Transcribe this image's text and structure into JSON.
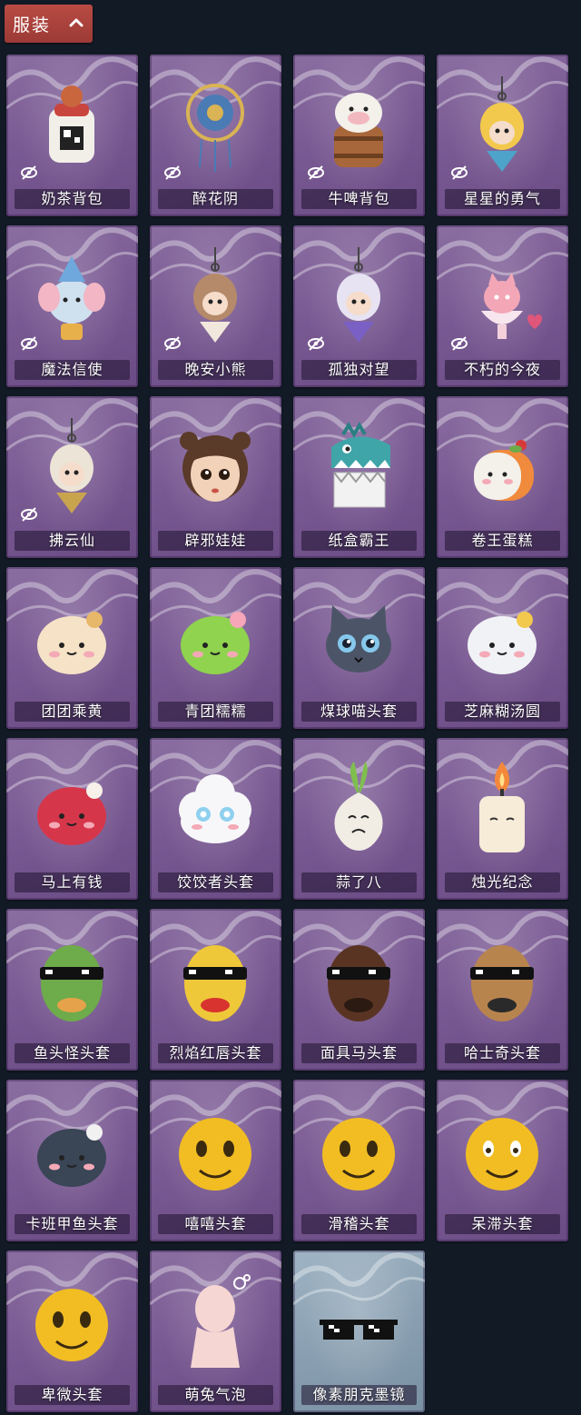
{
  "section": {
    "title": "服装"
  },
  "items": [
    {
      "name": "奶茶背包",
      "hidden": true,
      "art": "backpack",
      "c1": "#f2efe9",
      "c2": "#c9463e",
      "rarity": "purple"
    },
    {
      "name": "醉花阴",
      "hidden": true,
      "art": "ornament",
      "c1": "#4a7bb5",
      "c2": "#d9b354",
      "rarity": "purple"
    },
    {
      "name": "牛啤背包",
      "hidden": true,
      "art": "barrel",
      "c1": "#a8673a",
      "c2": "#f4f0ea",
      "rarity": "purple"
    },
    {
      "name": "星星的勇气",
      "hidden": true,
      "art": "charm",
      "c1": "#f2c94c",
      "c2": "#4da3c9",
      "rarity": "purple"
    },
    {
      "name": "魔法信使",
      "hidden": true,
      "art": "elephant",
      "c1": "#cfe0ef",
      "c2": "#e8b04a",
      "rarity": "purple"
    },
    {
      "name": "晚安小熊",
      "hidden": true,
      "art": "charm",
      "c1": "#b58a6a",
      "c2": "#f1e7dc",
      "rarity": "purple"
    },
    {
      "name": "孤独对望",
      "hidden": true,
      "art": "charm",
      "c1": "#e7e3f2",
      "c2": "#7a5fc4",
      "rarity": "purple"
    },
    {
      "name": "不朽的今夜",
      "hidden": true,
      "art": "sundae",
      "c1": "#f3a7b6",
      "c2": "#e0557a",
      "rarity": "purple"
    },
    {
      "name": "拂云仙",
      "hidden": true,
      "art": "charm",
      "c1": "#ece4d6",
      "c2": "#c9a44e",
      "rarity": "purple"
    },
    {
      "name": "辟邪娃娃",
      "hidden": false,
      "art": "doll",
      "c1": "#f2d2b8",
      "c2": "#5a3a28",
      "rarity": "purple"
    },
    {
      "name": "纸盒霸王",
      "hidden": false,
      "art": "dino",
      "c1": "#3fa5a8",
      "c2": "#f1f1f1",
      "rarity": "purple"
    },
    {
      "name": "卷王蛋糕",
      "hidden": false,
      "art": "roll",
      "c1": "#f4f0ea",
      "c2": "#f08a3c",
      "rarity": "purple"
    },
    {
      "name": "团团乘黄",
      "hidden": false,
      "art": "round",
      "c1": "#f6e2c6",
      "c2": "#e8b86a",
      "rarity": "purple"
    },
    {
      "name": "青团糯糯",
      "hidden": false,
      "art": "round",
      "c1": "#8fd34e",
      "c2": "#f6a6b8",
      "rarity": "purple"
    },
    {
      "name": "煤球喵头套",
      "hidden": false,
      "art": "cat",
      "c1": "#4c5568",
      "c2": "#86c8ec",
      "rarity": "purple"
    },
    {
      "name": "芝麻糊汤圆",
      "hidden": false,
      "art": "round",
      "c1": "#f1f2f6",
      "c2": "#f2c94c",
      "rarity": "purple"
    },
    {
      "name": "马上有钱",
      "hidden": false,
      "art": "round",
      "c1": "#d6364a",
      "c2": "#f7f1ea",
      "rarity": "purple"
    },
    {
      "name": "饺饺者头套",
      "hidden": false,
      "art": "cloud",
      "c1": "#f7f7f9",
      "c2": "#8fd0ee",
      "rarity": "purple"
    },
    {
      "name": "蒜了八",
      "hidden": false,
      "art": "garlic",
      "c1": "#f1ece4",
      "c2": "#7fbf4e",
      "rarity": "purple"
    },
    {
      "name": "烛光纪念",
      "hidden": false,
      "art": "candle",
      "c1": "#f6ecd8",
      "c2": "#f4883a",
      "rarity": "purple"
    },
    {
      "name": "鱼头怪头套",
      "hidden": false,
      "art": "mask",
      "c1": "#6eab4a",
      "c2": "#e6a24a",
      "rarity": "purple"
    },
    {
      "name": "烈焰红唇头套",
      "hidden": false,
      "art": "mask",
      "c1": "#efc83a",
      "c2": "#d8332f",
      "rarity": "purple"
    },
    {
      "name": "面具马头套",
      "hidden": false,
      "art": "mask",
      "c1": "#5a3423",
      "c2": "#2b1a12",
      "rarity": "purple"
    },
    {
      "name": "哈士奇头套",
      "hidden": false,
      "art": "mask",
      "c1": "#b8844e",
      "c2": "#2a2a2a",
      "rarity": "purple"
    },
    {
      "name": "卡班甲鱼头套",
      "hidden": false,
      "art": "round",
      "c1": "#3a4556",
      "c2": "#f1f1f1",
      "rarity": "purple"
    },
    {
      "name": "嘻嘻头套",
      "hidden": false,
      "art": "emoji",
      "c1": "#f2bd23",
      "c2": "#3a2a10",
      "rarity": "purple"
    },
    {
      "name": "滑稽头套",
      "hidden": false,
      "art": "emoji",
      "c1": "#f2bd23",
      "c2": "#e86a6a",
      "rarity": "purple"
    },
    {
      "name": "呆滞头套",
      "hidden": false,
      "art": "emoji",
      "c1": "#f2bd23",
      "c2": "#ffffff",
      "rarity": "purple"
    },
    {
      "name": "卑微头套",
      "hidden": false,
      "art": "emoji",
      "c1": "#f2bd23",
      "c2": "#3a2a10",
      "rarity": "purple"
    },
    {
      "name": "萌兔气泡",
      "hidden": false,
      "art": "figure",
      "c1": "#f5d6d2",
      "c2": "#ffffff",
      "rarity": "purple"
    },
    {
      "name": "像素朋克墨镜",
      "hidden": false,
      "art": "glasses",
      "c1": "#111111",
      "c2": "#ffffff",
      "rarity": "blue"
    }
  ]
}
